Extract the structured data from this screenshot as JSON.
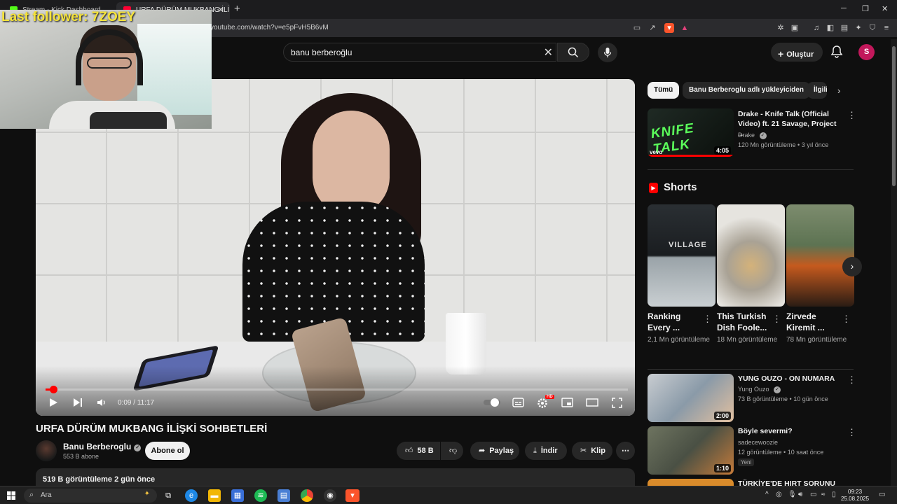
{
  "browser": {
    "tabs": [
      {
        "label": "Stream - Kick Dashboard",
        "fav_color": "#53fc18"
      },
      {
        "label": "URFA DÜRÜM MUKBANG İLİŞKİ",
        "fav_color": "#ff0033"
      }
    ],
    "url": "youtube.com/watch?v=e5pFvH5B6vM"
  },
  "overlay": {
    "last_follower": "Last follower: 7ZOEY"
  },
  "header": {
    "search_query": "banu berberoğlu",
    "create_label": "Oluştur",
    "avatar_letter": "S"
  },
  "player": {
    "time": "0:09 / 11:17",
    "progress_fraction": 0.013
  },
  "video": {
    "title": "URFA DÜRÜM MUKBANG İLİŞKİ SOHBETLERİ",
    "channel": "Banu Berberoglu",
    "subscribers": "553 B abone",
    "subscribe_label": "Abone ol",
    "likes": "58 B",
    "share_label": "Paylaş",
    "download_label": "İndir",
    "clip_label": "Klip",
    "description_meta": "519 B görüntüleme  2 gün önce"
  },
  "sidebar": {
    "chips": [
      "Tümü",
      "Banu Berberoglu adlı yükleyiciden",
      "İlgili"
    ],
    "top_video": {
      "title": "Drake - Knife Talk (Official Video) ft. 21 Savage, Project ...",
      "channel": "Drake",
      "meta": "120 Mn görüntüleme • 3 yıl önce",
      "duration": "4:05",
      "thumb_text": "KNIFE TALK"
    },
    "shorts_title": "Shorts",
    "shorts": [
      {
        "title": "Ranking Every ...",
        "views": "2,1 Mn görüntüleme"
      },
      {
        "title": "This Turkish Dish Foole...",
        "views": "18 Mn görüntüleme"
      },
      {
        "title": "Zirvede Kiremit ...",
        "views": "78 Mn görüntüleme"
      }
    ],
    "videos": [
      {
        "title": "YUNG OUZO - ON NUMARA",
        "channel": "Yung Ouzo",
        "meta": "73 B görüntüleme • 10 gün önce",
        "duration": "2:00"
      },
      {
        "title": "Böyle severmi?",
        "channel": "sadecewoozie",
        "meta": "12 görüntüleme • 10 saat önce",
        "duration": "1:10",
        "badge": "Yeni"
      },
      {
        "title": "TÜRKİYE'DE HIRT SORUNU",
        "channel": "",
        "meta": "",
        "duration": ""
      }
    ]
  },
  "taskbar": {
    "search_placeholder": "Ara",
    "time": "09:23",
    "date": "25.08.2025"
  }
}
